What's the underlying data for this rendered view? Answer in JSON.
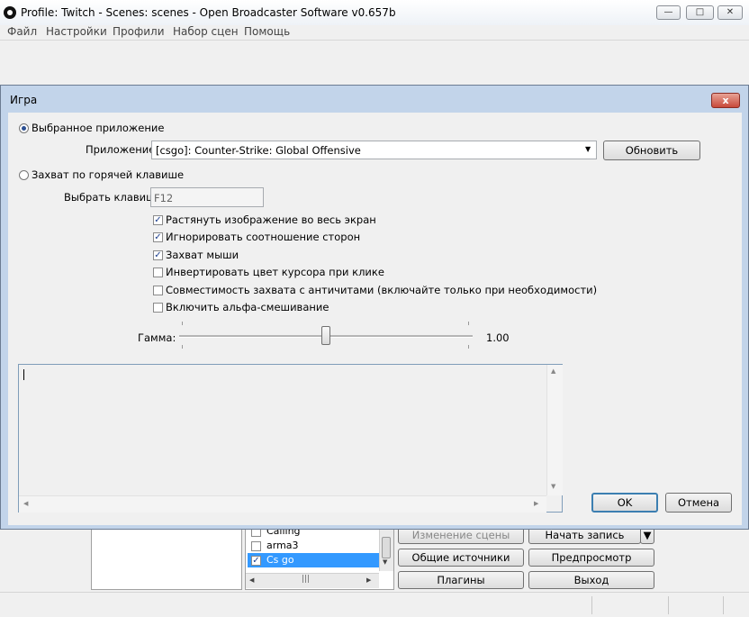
{
  "window": {
    "title": "Profile: Twitch - Scenes: scenes - Open Broadcaster Software v0.657b"
  },
  "menu": [
    "Файл",
    "Настройки",
    "Профили",
    "Набор сцен",
    "Помощь"
  ],
  "dialog": {
    "title": "Игра",
    "close": "x",
    "mode_app": "Выбранное приложение",
    "app_label": "Приложение:",
    "app_value": "[csgo]: Counter-Strike: Global Offensive",
    "refresh_button": "Обновить",
    "mode_hotkey": "Захват по горячей клавише",
    "hotkey_label": "Выбрать клавишу",
    "hotkey_value": "F12",
    "options": [
      {
        "label": "Растянуть изображение во весь экран",
        "checked": true
      },
      {
        "label": "Игнорировать соотношение сторон",
        "checked": true
      },
      {
        "label": "Захват мыши",
        "checked": true
      },
      {
        "label": "Инвертировать цвет курсора при клике",
        "checked": false
      },
      {
        "label": "Совместимость захвата с античитами (включайте только при необходимости)",
        "checked": false
      },
      {
        "label": "Включить альфа-смешивание",
        "checked": false
      }
    ],
    "gamma_label": "Гамма:",
    "gamma_value": "1.00",
    "gamma_level": 0.5,
    "ok_button": "OK",
    "cancel_button": "Отмена"
  },
  "sources": [
    {
      "name": "Calling",
      "checked": false
    },
    {
      "name": "arma3",
      "checked": false
    },
    {
      "name": "Cs go",
      "checked": true
    }
  ],
  "buttons": {
    "edit_scene": "Изменение сцены",
    "start_recording": "Начать запись",
    "global_sources": "Общие источники",
    "preview": "Предпросмотр",
    "plugins": "Плагины",
    "exit": "Выход"
  },
  "colors": {
    "accent": "#3399ff",
    "selection": "#3399ff",
    "dialog_frame": "#c2d4ea"
  }
}
